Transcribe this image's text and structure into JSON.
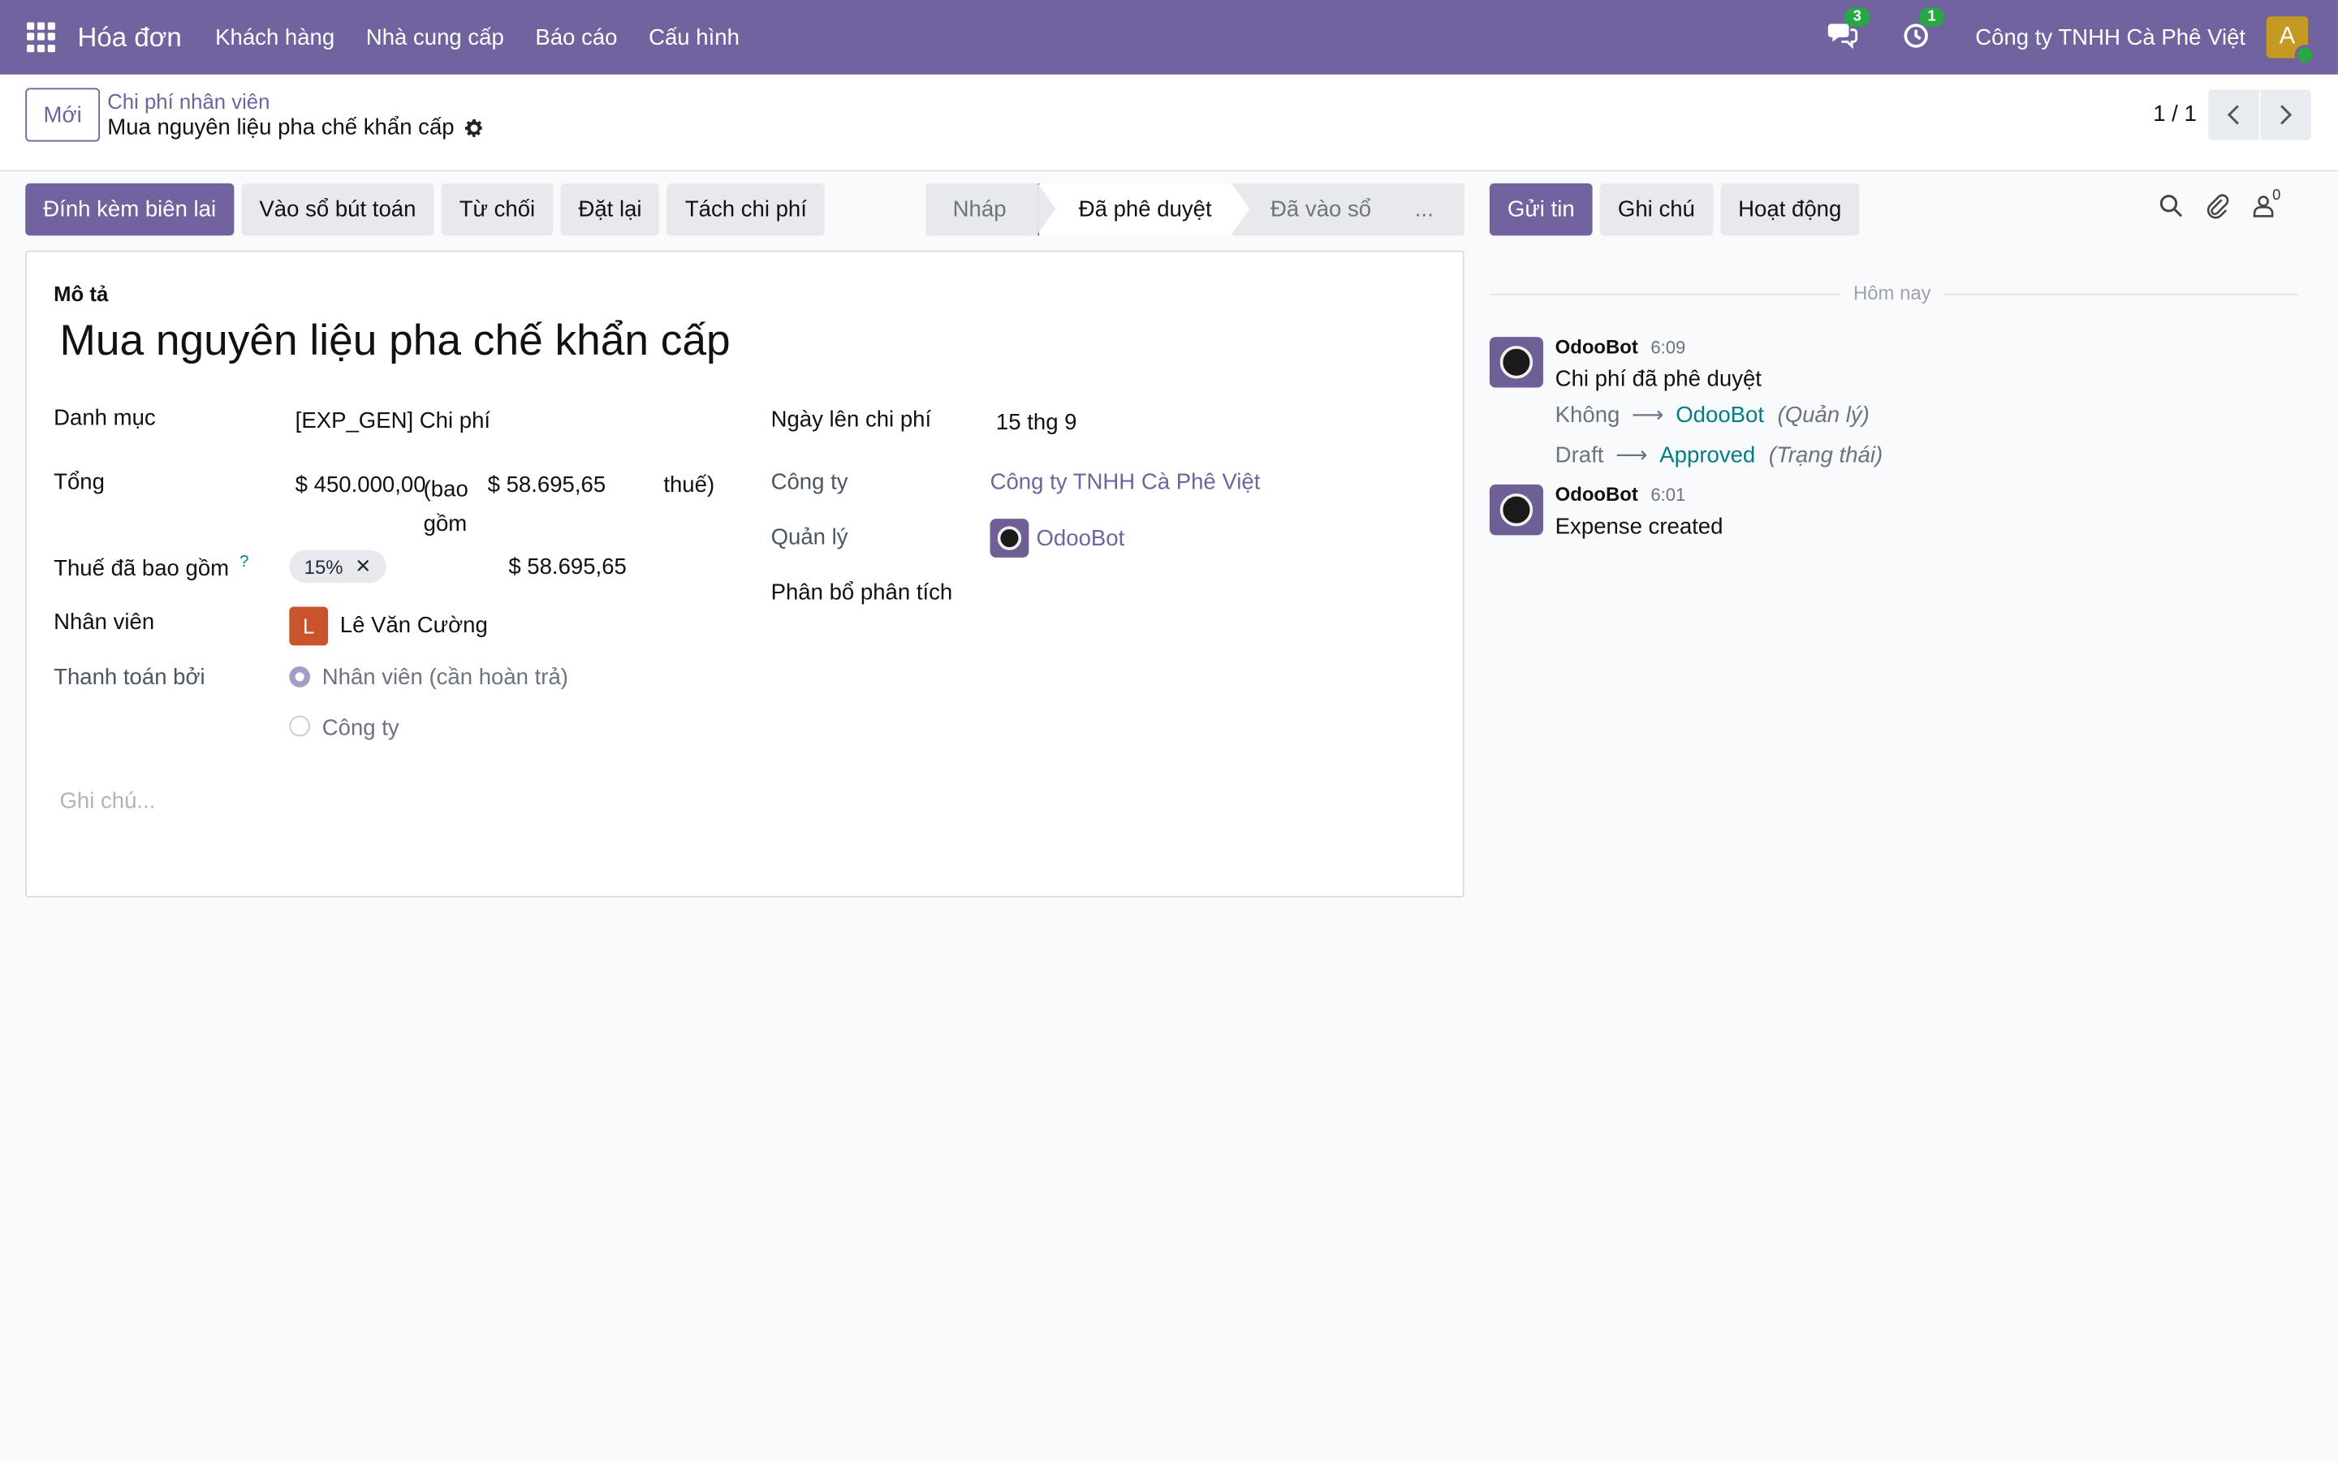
{
  "navbar": {
    "app_name": "Hóa đơn",
    "menu": [
      "Khách hàng",
      "Nhà cung cấp",
      "Báo cáo",
      "Cấu hình"
    ],
    "messages_badge": "3",
    "activities_badge": "1",
    "company": "Công ty TNHH Cà Phê Việt",
    "user_initial": "A"
  },
  "control": {
    "new_button": "Mới",
    "breadcrumb": "Chi phí nhân viên",
    "record_title": "Mua nguyên liệu pha chế khẩn cấp",
    "pager": "1 / 1"
  },
  "actions": [
    "Đính kèm biên lai",
    "Vào sổ bút toán",
    "Từ chối",
    "Đặt lại",
    "Tách chi phí"
  ],
  "status": {
    "stages": [
      "Nháp",
      "Đã phê duyệt",
      "Đã vào sổ",
      "..."
    ],
    "active": "Đã phê duyệt"
  },
  "form": {
    "description_label": "Mô tả",
    "description": "Mua nguyên liệu pha chế khẩn cấp",
    "category_label": "Danh mục",
    "category": "[EXP_GEN] Chi phí",
    "total_label": "Tổng",
    "total_amount": "$ 450.000,00",
    "total_paren_open": "(bao gồm",
    "total_tax_amount": "$ 58.695,65",
    "total_paren_close": "thuế)",
    "tax_label": "Thuế đã bao gồm",
    "tax_help": "?",
    "tax_tag": "15%",
    "tax_amount": "$ 58.695,65",
    "employee_label": "Nhân viên",
    "employee_initial": "L",
    "employee": "Lê Văn Cường",
    "paid_by_label": "Thanh toán bởi",
    "paid_by_options": [
      "Nhân viên (cần hoàn trả)",
      "Công ty"
    ],
    "date_label": "Ngày lên chi phí",
    "date": "15 thg 9",
    "company_label": "Công ty",
    "company": "Công ty TNHH Cà Phê Việt",
    "manager_label": "Quản lý",
    "manager": "OdooBot",
    "analytic_label": "Phân bổ phân tích",
    "note_placeholder": "Ghi chú..."
  },
  "chatter": {
    "buttons": [
      "Gửi tin",
      "Ghi chú",
      "Hoạt động"
    ],
    "follower_count": "0",
    "today": "Hôm nay",
    "messages": [
      {
        "author": "OdooBot",
        "time": "6:09",
        "text": "Chi phí đã phê duyệt",
        "tracking": [
          {
            "old": "Không",
            "new": "OdooBot",
            "field": "(Quản lý)"
          },
          {
            "old": "Draft",
            "new": "Approved",
            "field": "(Trạng thái)"
          }
        ]
      },
      {
        "author": "OdooBot",
        "time": "6:01",
        "text": "Expense created"
      }
    ]
  }
}
